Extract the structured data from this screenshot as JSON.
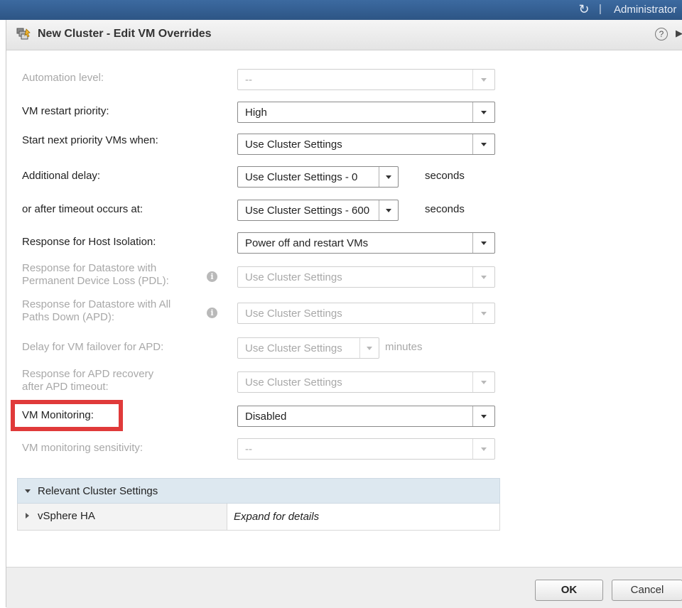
{
  "topbar": {
    "refresh_icon": "refresh-icon",
    "separator": "|",
    "user": "Administrator"
  },
  "dialog": {
    "title": "New Cluster - Edit VM Overrides",
    "help_label": "?",
    "expand_label": "▶|"
  },
  "fields": {
    "automation_level": {
      "label": "Automation level:",
      "value": "--"
    },
    "restart_priority": {
      "label": "VM restart priority:",
      "value": "High"
    },
    "start_next": {
      "label": "Start next priority VMs when:",
      "value": "Use Cluster Settings"
    },
    "additional_delay": {
      "label": "Additional delay:",
      "value": "Use Cluster Settings - 0",
      "unit": "seconds"
    },
    "timeout": {
      "label": "or after timeout occurs at:",
      "value": "Use Cluster Settings - 600",
      "unit": "seconds"
    },
    "host_isolation": {
      "label": "Response for Host Isolation:",
      "value": "Power off and restart VMs"
    },
    "pdl": {
      "label_line1": "Response for Datastore with",
      "label_line2": "Permanent Device Loss (PDL):",
      "value": "Use Cluster Settings",
      "info": "i"
    },
    "apd": {
      "label_line1": "Response for Datastore with All",
      "label_line2": "Paths Down (APD):",
      "value": "Use Cluster Settings",
      "info": "i"
    },
    "apd_delay": {
      "label": "Delay for VM failover for APD:",
      "value": "Use Cluster Settings",
      "unit": "minutes"
    },
    "apd_recovery": {
      "label_line1": "Response for APD recovery",
      "label_line2": "after APD timeout:",
      "value": "Use Cluster Settings"
    },
    "vm_monitoring": {
      "label": "VM Monitoring:",
      "value": "Disabled"
    },
    "monitoring_sensitivity": {
      "label": "VM monitoring sensitivity:",
      "value": "--"
    }
  },
  "relevant": {
    "header": "Relevant Cluster Settings",
    "row_name": "vSphere HA",
    "row_detail": "Expand for details"
  },
  "buttons": {
    "ok": "OK",
    "cancel": "Cancel"
  },
  "colors": {
    "highlight": "#e03a3a",
    "topbar": "#2d5585",
    "panel_header": "#dde8f0"
  }
}
